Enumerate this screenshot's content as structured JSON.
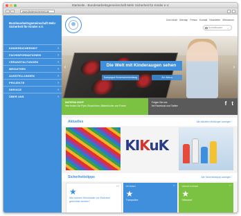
{
  "window": {
    "title": "Startseite - Bundesarbeitsgemeinschaft Mehr Sicherheit für Kinder e.V.",
    "url": "www.kindersicherheit.de"
  },
  "sidebar": {
    "brand": "Bundesarbeitsgemeinschaft Mehr Sicherheit für Kinder e.V.",
    "items": [
      {
        "label": "KINDERSICHERHEIT"
      },
      {
        "label": "FACHINFORMATIONEN"
      },
      {
        "label": "VERANSTALTUNGEN"
      },
      {
        "label": "MEDIATHEK"
      },
      {
        "label": "AUSSTELLUNGEN"
      },
      {
        "label": "PROJEKTE"
      },
      {
        "label": "SERVICE"
      },
      {
        "label": "ÜBER UNS"
      }
    ]
  },
  "header": {
    "top_links": [
      "Zum Inhalt",
      "Sitemap",
      "Presse",
      "Kontakt",
      "Newsletter",
      "Mitmachen"
    ],
    "search_placeholder": "Schnellsuche"
  },
  "hero": {
    "title": "Die Welt mit Kinderaugen sehen",
    "btn1": "Kampagne Kindersicherheitstag",
    "btn2": "Zur Aktion",
    "prev": "‹",
    "next": "›"
  },
  "info": {
    "green_title": "MATERIALSHOP",
    "green_text": "Hier finden Sie Flyer, Broschüren, Bilderbücher und Poster",
    "grey_title": "Folgen Sie uns",
    "grey_text": "bei Facebook und Twitter",
    "facebook": "f",
    "twitter": "t"
  },
  "news": {
    "heading": "Aktuelles",
    "more": "Alle aktuellen Meldungen anzeigen ›",
    "card2_prefix": "KI",
    "card2_mid": "K",
    "card2_suffix": "uK"
  },
  "tips": {
    "heading": "Sicherheitstipps",
    "more": "Alle Sicherheitstipps anzeigen ›",
    "cards": [
      {
        "tag": "",
        "text": "Wie können Kleinkinder vor Ertrinken geschützt werden?",
        "ctrls": "‹ ›"
      },
      {
        "tag": "Stürzen",
        "text": "Trampoline",
        "ctrls": "‹ ›"
      },
      {
        "tag": "Vergiftungen",
        "text": "Giftnotruf",
        "ctrls": "‹ ›"
      }
    ]
  }
}
